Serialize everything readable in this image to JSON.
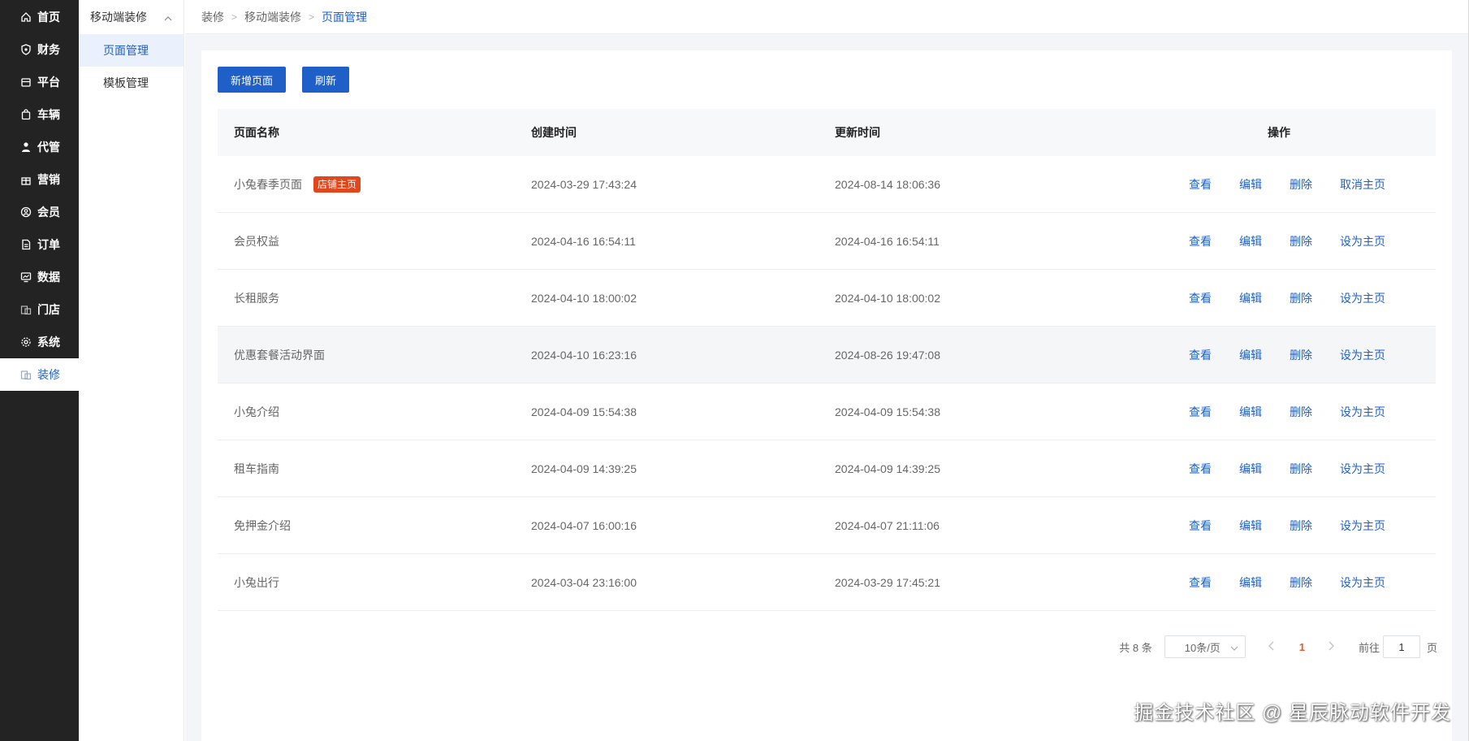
{
  "sidebar": {
    "items": [
      {
        "label": "首页",
        "icon": "home-icon"
      },
      {
        "label": "财务",
        "icon": "shield-icon"
      },
      {
        "label": "平台",
        "icon": "store-icon"
      },
      {
        "label": "车辆",
        "icon": "bag-icon"
      },
      {
        "label": "代管",
        "icon": "person-icon"
      },
      {
        "label": "营销",
        "icon": "gift-icon"
      },
      {
        "label": "会员",
        "icon": "user-circle-icon"
      },
      {
        "label": "订单",
        "icon": "document-icon"
      },
      {
        "label": "数据",
        "icon": "monitor-icon"
      },
      {
        "label": "门店",
        "icon": "shop-icon"
      },
      {
        "label": "系统",
        "icon": "gear-icon"
      },
      {
        "label": "装修",
        "icon": "decorate-icon"
      }
    ],
    "active_index": 11
  },
  "submenu": {
    "title": "移动端装修",
    "items": [
      {
        "label": "页面管理"
      },
      {
        "label": "模板管理"
      }
    ]
  },
  "breadcrumb": [
    "装修",
    "移动端装修",
    "页面管理"
  ],
  "toolbar": {
    "add_label": "新增页面",
    "refresh_label": "刷新"
  },
  "table": {
    "headers": [
      "页面名称",
      "创建时间",
      "更新时间",
      "操作"
    ],
    "actions": {
      "view": "查看",
      "edit": "编辑",
      "delete": "删除",
      "set_home": "设为主页",
      "unset_home": "取消主页"
    },
    "home_tag": "店铺主页",
    "rows": [
      {
        "name": "小兔春季页面",
        "created": "2024-03-29 17:43:24",
        "updated": "2024-08-14 18:06:36",
        "is_home": true
      },
      {
        "name": "会员权益",
        "created": "2024-04-16 16:54:11",
        "updated": "2024-04-16 16:54:11",
        "is_home": false
      },
      {
        "name": "长租服务",
        "created": "2024-04-10 18:00:02",
        "updated": "2024-04-10 18:00:02",
        "is_home": false
      },
      {
        "name": "优惠套餐活动界面",
        "created": "2024-04-10 16:23:16",
        "updated": "2024-08-26 19:47:08",
        "is_home": false
      },
      {
        "name": "小兔介绍",
        "created": "2024-04-09 15:54:38",
        "updated": "2024-04-09 15:54:38",
        "is_home": false
      },
      {
        "name": "租车指南",
        "created": "2024-04-09 14:39:25",
        "updated": "2024-04-09 14:39:25",
        "is_home": false
      },
      {
        "name": "免押金介绍",
        "created": "2024-04-07 16:00:16",
        "updated": "2024-04-07 21:11:06",
        "is_home": false
      },
      {
        "name": "小兔出行",
        "created": "2024-03-04 23:16:00",
        "updated": "2024-03-29 17:45:21",
        "is_home": false
      }
    ]
  },
  "pagination": {
    "total_text": "共 8 条",
    "page_size": "10条/页",
    "current_page": "1",
    "goto_label": "前往",
    "goto_value": "1",
    "page_unit": "页"
  },
  "watermark": "掘金技术社区 @ 星辰脉动软件开发",
  "colors": {
    "primary": "#1f5fc8",
    "sidebar_bg": "#232323",
    "tag_bg": "#e2461d"
  }
}
